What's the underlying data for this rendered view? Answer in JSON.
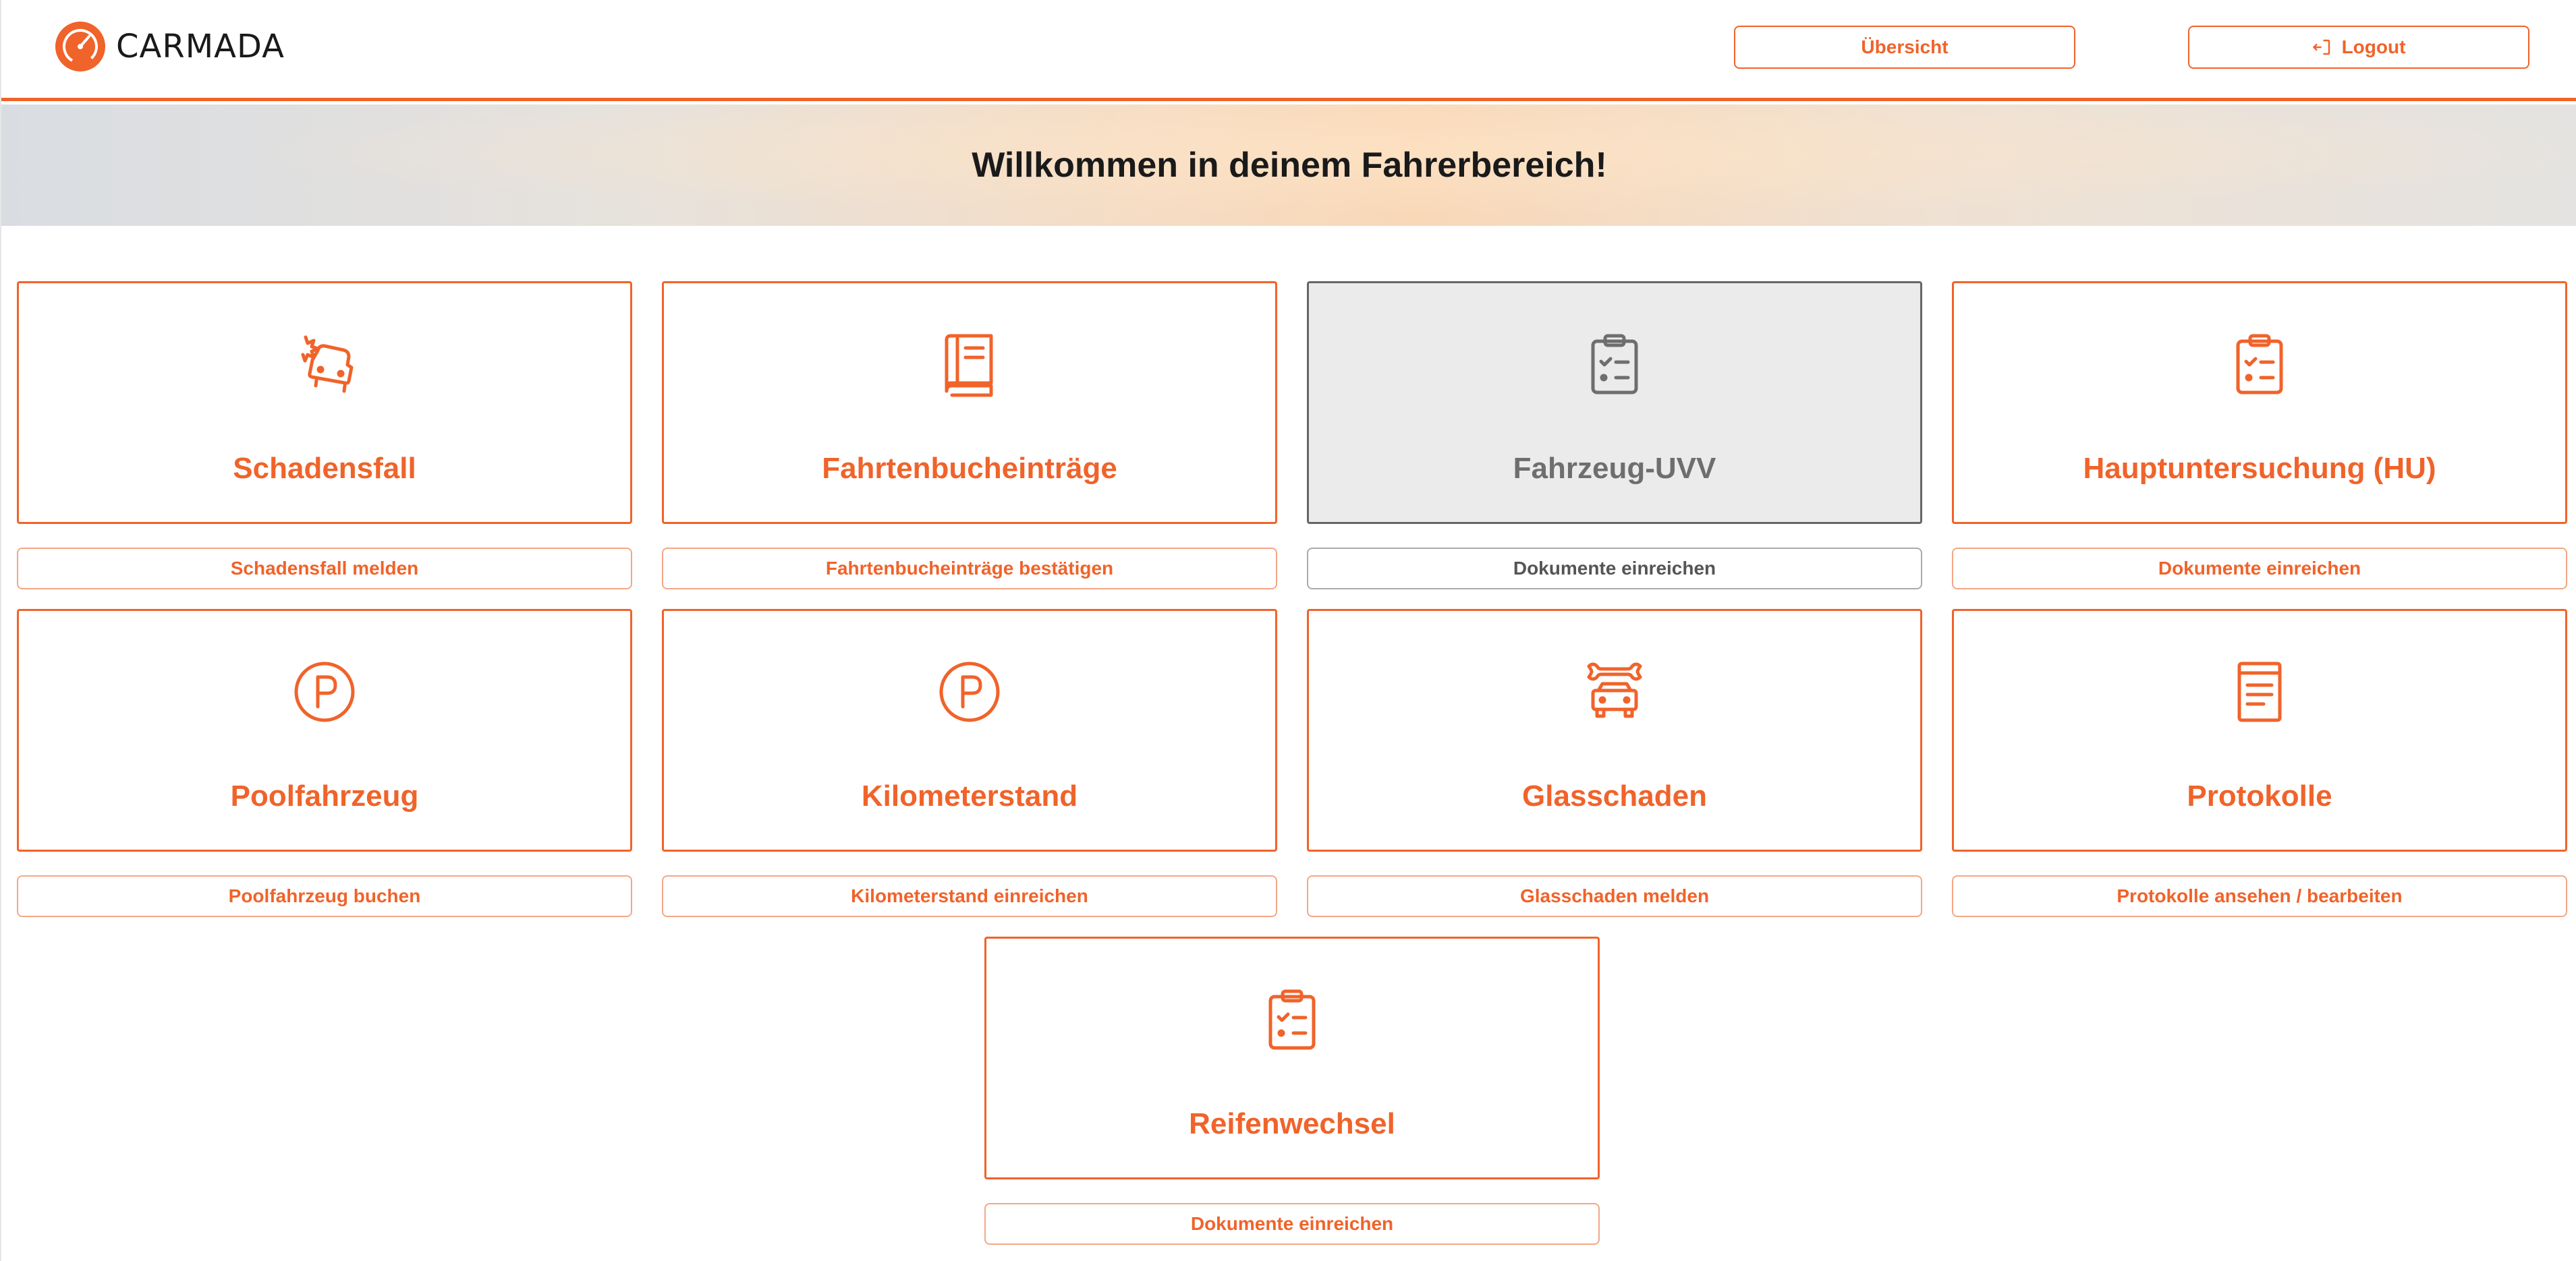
{
  "header": {
    "brand": "CARMADA",
    "overview_label": "Übersicht",
    "logout_label": "Logout"
  },
  "banner": {
    "title": "Willkommen in deinem Fahrerbereich!"
  },
  "colors": {
    "accent": "#f0632a",
    "disabled_bg": "#ebebeb",
    "disabled_text": "#6e6e6e"
  },
  "cards": [
    {
      "title": "Schadensfall",
      "icon": "car-crash-icon",
      "action": "Schadensfall melden",
      "enabled": true
    },
    {
      "title": "Fahrtenbucheinträge",
      "icon": "book-icon",
      "action": "Fahrtenbucheinträge bestätigen",
      "enabled": true
    },
    {
      "title": "Fahrzeug-UVV",
      "icon": "clipboard-check-icon",
      "action": "Dokumente einreichen",
      "enabled": false
    },
    {
      "title": "Hauptuntersuchung (HU)",
      "icon": "clipboard-check-icon",
      "action": "Dokumente einreichen",
      "enabled": true
    },
    {
      "title": "Poolfahrzeug",
      "icon": "parking-icon",
      "action": "Poolfahrzeug buchen",
      "enabled": true
    },
    {
      "title": "Kilometerstand",
      "icon": "parking-icon",
      "action": "Kilometerstand einreichen",
      "enabled": true
    },
    {
      "title": "Glasschaden",
      "icon": "car-wrench-icon",
      "action": "Glasschaden melden",
      "enabled": true
    },
    {
      "title": "Protokolle",
      "icon": "document-list-icon",
      "action": "Protokolle ansehen / bearbeiten",
      "enabled": true
    },
    {
      "title": "Reifenwechsel",
      "icon": "clipboard-check-icon",
      "action": "Dokumente einreichen",
      "enabled": true
    }
  ]
}
